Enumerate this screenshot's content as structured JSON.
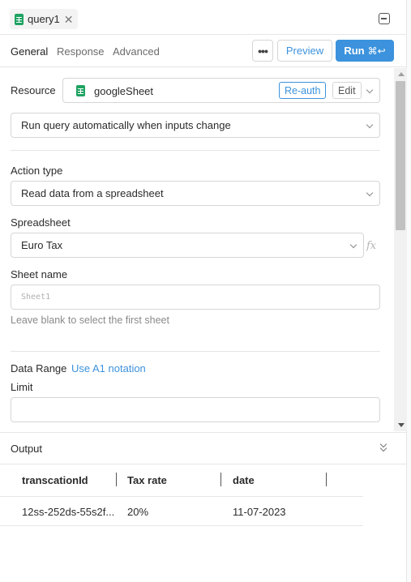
{
  "tab": {
    "label": "query1",
    "close": "✕"
  },
  "subtabs": [
    "General",
    "Response",
    "Advanced"
  ],
  "toolbar": {
    "more": "•••",
    "preview": "Preview",
    "run": "Run",
    "run_shortcut": "⌘↩"
  },
  "resource": {
    "label": "Resource",
    "name": "googleSheet",
    "reauth": "Re-auth",
    "edit": "Edit"
  },
  "trigger": {
    "value": "Run query automatically when inputs change"
  },
  "action_type": {
    "label": "Action type",
    "value": "Read data from a spreadsheet"
  },
  "spreadsheet": {
    "label": "Spreadsheet",
    "value": "Euro Tax",
    "fx": "fx"
  },
  "sheet_name": {
    "label": "Sheet name",
    "placeholder": "Sheet1",
    "help": "Leave blank to select the first sheet"
  },
  "data_range": {
    "label": "Data Range",
    "link": "Use A1 notation"
  },
  "limit": {
    "label": "Limit",
    "value": ""
  },
  "output": {
    "title": "Output",
    "columns": [
      "transcationId",
      "Tax rate",
      "date"
    ],
    "rows": [
      [
        "12ss-252ds-55s2f...",
        "20%",
        "11-07-2023"
      ]
    ]
  },
  "colors": {
    "accent": "#3c92dc",
    "sheets_green": "#1ea362"
  }
}
